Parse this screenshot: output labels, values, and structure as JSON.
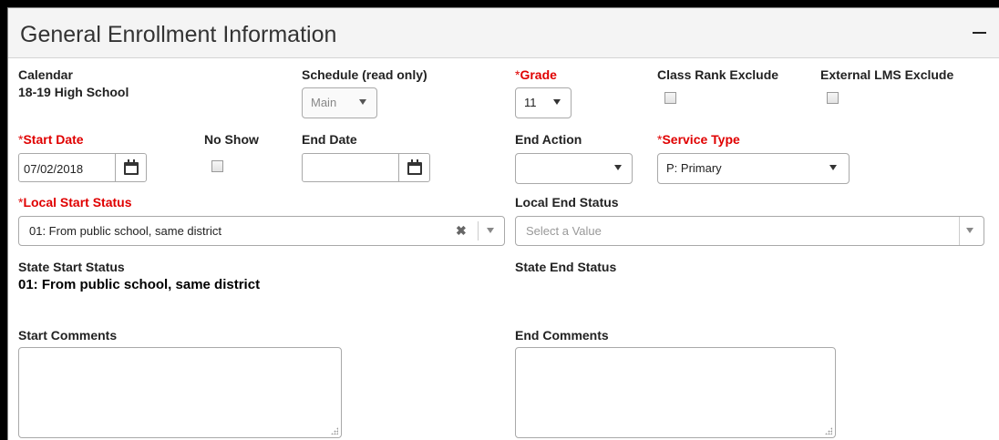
{
  "panel": {
    "title": "General Enrollment Information",
    "collapse_icon": "minus-icon"
  },
  "calendar": {
    "label": "Calendar",
    "value": "18-19 High School"
  },
  "schedule": {
    "label": "Schedule (read only)",
    "selected": "Main"
  },
  "grade": {
    "required_mark": "*",
    "label": "Grade",
    "selected": "11"
  },
  "class_rank_exclude": {
    "label": "Class Rank Exclude",
    "checked": false
  },
  "external_lms_exclude": {
    "label": "External LMS Exclude",
    "checked": false
  },
  "start_date": {
    "required_mark": "*",
    "label": "Start Date",
    "value": "07/02/2018"
  },
  "no_show": {
    "label": "No Show",
    "checked": false
  },
  "end_date": {
    "label": "End Date",
    "value": ""
  },
  "end_action": {
    "label": "End Action",
    "selected": ""
  },
  "service_type": {
    "required_mark": "*",
    "label": "Service Type",
    "selected": "P: Primary"
  },
  "local_start_status": {
    "required_mark": "*",
    "label": "Local Start Status",
    "selected": "01: From public school, same district"
  },
  "local_end_status": {
    "label": "Local End Status",
    "placeholder": "Select a Value"
  },
  "state_start_status": {
    "label": "State Start Status",
    "value": "01: From public school, same district"
  },
  "state_end_status": {
    "label": "State End Status",
    "value": ""
  },
  "start_comments": {
    "label": "Start Comments",
    "value": ""
  },
  "end_comments": {
    "label": "End Comments",
    "value": ""
  },
  "colors": {
    "required": "#e00000",
    "header_bg": "#f4f4f4",
    "border": "#a9a9a9"
  }
}
